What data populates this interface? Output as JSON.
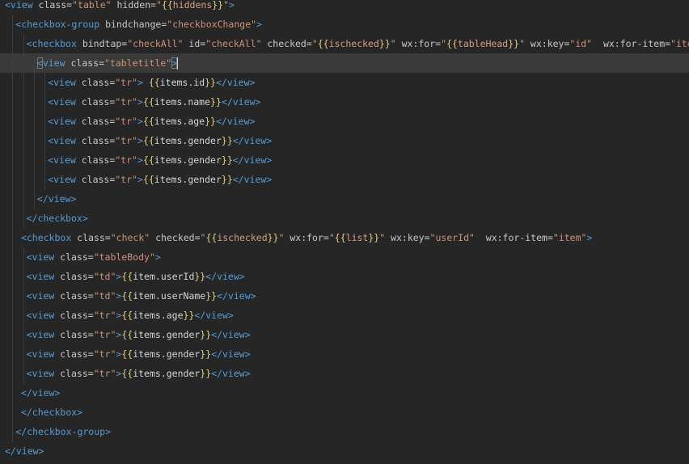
{
  "editor": {
    "language": "wxml",
    "colors": {
      "background": "#262626",
      "current_line": "#3a3a3a",
      "tag": "#569cd6",
      "attribute": "#c8c8c8",
      "string": "#ce9178",
      "mustache": "#e0d080",
      "text": "#d4d4d4"
    },
    "current_line_index": 3,
    "lines": [
      {
        "indent": 0,
        "tokens": [
          [
            "tag",
            "<view"
          ],
          [
            "attr",
            " class"
          ],
          [
            "eq",
            "="
          ],
          [
            "str",
            "\"table\""
          ],
          [
            "attr",
            " hidden"
          ],
          [
            "eq",
            "="
          ],
          [
            "str",
            "\""
          ],
          [
            "must",
            "{{"
          ],
          [
            "strmust",
            "hiddens"
          ],
          [
            "must",
            "}}"
          ],
          [
            "str",
            "\""
          ],
          [
            "tag",
            ">"
          ]
        ]
      },
      {
        "indent": 1,
        "tokens": [
          [
            "tag",
            "<checkbox-group"
          ],
          [
            "attr",
            " bindchange"
          ],
          [
            "eq",
            "="
          ],
          [
            "str",
            "\"checkboxChange\""
          ],
          [
            "tag",
            ">"
          ]
        ]
      },
      {
        "indent": 2,
        "tokens": [
          [
            "tag",
            "<checkbox"
          ],
          [
            "attr",
            " bindtap"
          ],
          [
            "eq",
            "="
          ],
          [
            "str",
            "\"checkAll\""
          ],
          [
            "attr",
            " id"
          ],
          [
            "eq",
            "="
          ],
          [
            "str",
            "\"checkAll\""
          ],
          [
            "attr",
            " checked"
          ],
          [
            "eq",
            "="
          ],
          [
            "str",
            "\""
          ],
          [
            "must",
            "{{"
          ],
          [
            "strmust",
            "ischecked"
          ],
          [
            "must",
            "}}"
          ],
          [
            "str",
            "\""
          ],
          [
            "attr",
            " wx:for"
          ],
          [
            "eq",
            "="
          ],
          [
            "str",
            "\""
          ],
          [
            "must",
            "{{"
          ],
          [
            "strmust",
            "tableHead"
          ],
          [
            "must",
            "}}"
          ],
          [
            "str",
            "\""
          ],
          [
            "attr",
            " wx:key"
          ],
          [
            "eq",
            "="
          ],
          [
            "str",
            "\"id\""
          ],
          [
            "attr",
            "  wx:for-item"
          ],
          [
            "eq",
            "="
          ],
          [
            "str",
            "\"items\""
          ]
        ]
      },
      {
        "indent": 3,
        "tokens": [
          [
            "bracketbox",
            "<"
          ],
          [
            "tag",
            "view"
          ],
          [
            "attr",
            " class"
          ],
          [
            "eq",
            "="
          ],
          [
            "str",
            "\"tabletitle\""
          ],
          [
            "bracketbox",
            ">"
          ],
          [
            "caret",
            ""
          ]
        ]
      },
      {
        "indent": 4,
        "tokens": [
          [
            "tag",
            "<view"
          ],
          [
            "attr",
            " class"
          ],
          [
            "eq",
            "="
          ],
          [
            "str",
            "\"tr\""
          ],
          [
            "tag",
            ">"
          ],
          [
            "text",
            " "
          ],
          [
            "must",
            "{{"
          ],
          [
            "text",
            "items.id"
          ],
          [
            "must",
            "}}"
          ],
          [
            "tag",
            "</view>"
          ]
        ]
      },
      {
        "indent": 4,
        "tokens": [
          [
            "tag",
            "<view"
          ],
          [
            "attr",
            " class"
          ],
          [
            "eq",
            "="
          ],
          [
            "str",
            "\"tr\""
          ],
          [
            "tag",
            ">"
          ],
          [
            "must",
            "{{"
          ],
          [
            "text",
            "items.name"
          ],
          [
            "must",
            "}}"
          ],
          [
            "tag",
            "</view>"
          ]
        ]
      },
      {
        "indent": 4,
        "tokens": [
          [
            "tag",
            "<view"
          ],
          [
            "attr",
            " class"
          ],
          [
            "eq",
            "="
          ],
          [
            "str",
            "\"tr\""
          ],
          [
            "tag",
            ">"
          ],
          [
            "must",
            "{{"
          ],
          [
            "text",
            "items.age"
          ],
          [
            "must",
            "}}"
          ],
          [
            "tag",
            "</view>"
          ]
        ]
      },
      {
        "indent": 4,
        "tokens": [
          [
            "tag",
            "<view"
          ],
          [
            "attr",
            " class"
          ],
          [
            "eq",
            "="
          ],
          [
            "str",
            "\"tr\""
          ],
          [
            "tag",
            ">"
          ],
          [
            "must",
            "{{"
          ],
          [
            "text",
            "items.gender"
          ],
          [
            "must",
            "}}"
          ],
          [
            "tag",
            "</view>"
          ]
        ]
      },
      {
        "indent": 4,
        "tokens": [
          [
            "tag",
            "<view"
          ],
          [
            "attr",
            " class"
          ],
          [
            "eq",
            "="
          ],
          [
            "str",
            "\"tr\""
          ],
          [
            "tag",
            ">"
          ],
          [
            "must",
            "{{"
          ],
          [
            "text",
            "items.gender"
          ],
          [
            "must",
            "}}"
          ],
          [
            "tag",
            "</view>"
          ]
        ]
      },
      {
        "indent": 4,
        "tokens": [
          [
            "tag",
            "<view"
          ],
          [
            "attr",
            " class"
          ],
          [
            "eq",
            "="
          ],
          [
            "str",
            "\"tr\""
          ],
          [
            "tag",
            ">"
          ],
          [
            "must",
            "{{"
          ],
          [
            "text",
            "items.gender"
          ],
          [
            "must",
            "}}"
          ],
          [
            "tag",
            "</view>"
          ]
        ]
      },
      {
        "indent": 3,
        "tokens": [
          [
            "tag",
            "</view>"
          ]
        ]
      },
      {
        "indent": 2,
        "tokens": [
          [
            "tag",
            "</checkbox>"
          ]
        ]
      },
      {
        "indent": 1.5,
        "tokens": [
          [
            "tag",
            "<checkbox"
          ],
          [
            "attr",
            " class"
          ],
          [
            "eq",
            "="
          ],
          [
            "str",
            "\"check\""
          ],
          [
            "attr",
            " checked"
          ],
          [
            "eq",
            "="
          ],
          [
            "str",
            "\""
          ],
          [
            "must",
            "{{"
          ],
          [
            "strmust",
            "ischecked"
          ],
          [
            "must",
            "}}"
          ],
          [
            "str",
            "\""
          ],
          [
            "attr",
            " wx:for"
          ],
          [
            "eq",
            "="
          ],
          [
            "str",
            "\""
          ],
          [
            "must",
            "{{"
          ],
          [
            "strmust",
            "list"
          ],
          [
            "must",
            "}}"
          ],
          [
            "str",
            "\""
          ],
          [
            "attr",
            " wx:key"
          ],
          [
            "eq",
            "="
          ],
          [
            "str",
            "\"userId\""
          ],
          [
            "attr",
            "  wx:for-item"
          ],
          [
            "eq",
            "="
          ],
          [
            "str",
            "\"item\""
          ],
          [
            "tag",
            ">"
          ]
        ]
      },
      {
        "indent": 2,
        "tokens": [
          [
            "tag",
            "<view"
          ],
          [
            "attr",
            " class"
          ],
          [
            "eq",
            "="
          ],
          [
            "str",
            "\"tableBody\""
          ],
          [
            "tag",
            ">"
          ]
        ]
      },
      {
        "indent": 2,
        "tokens": [
          [
            "tag",
            "<view"
          ],
          [
            "attr",
            " class"
          ],
          [
            "eq",
            "="
          ],
          [
            "str",
            "\"td\""
          ],
          [
            "tag",
            ">"
          ],
          [
            "must",
            "{{"
          ],
          [
            "text",
            "item.userId"
          ],
          [
            "must",
            "}}"
          ],
          [
            "tag",
            "</view>"
          ]
        ]
      },
      {
        "indent": 2,
        "tokens": [
          [
            "tag",
            "<view"
          ],
          [
            "attr",
            " class"
          ],
          [
            "eq",
            "="
          ],
          [
            "str",
            "\"td\""
          ],
          [
            "tag",
            ">"
          ],
          [
            "must",
            "{{"
          ],
          [
            "text",
            "item.userName"
          ],
          [
            "must",
            "}}"
          ],
          [
            "tag",
            "</view>"
          ]
        ]
      },
      {
        "indent": 2,
        "tokens": [
          [
            "tag",
            "<view"
          ],
          [
            "attr",
            " class"
          ],
          [
            "eq",
            "="
          ],
          [
            "str",
            "\"tr\""
          ],
          [
            "tag",
            ">"
          ],
          [
            "must",
            "{{"
          ],
          [
            "text",
            "items.age"
          ],
          [
            "must",
            "}}"
          ],
          [
            "tag",
            "</view>"
          ]
        ]
      },
      {
        "indent": 2,
        "tokens": [
          [
            "tag",
            "<view"
          ],
          [
            "attr",
            " class"
          ],
          [
            "eq",
            "="
          ],
          [
            "str",
            "\"tr\""
          ],
          [
            "tag",
            ">"
          ],
          [
            "must",
            "{{"
          ],
          [
            "text",
            "items.gender"
          ],
          [
            "must",
            "}}"
          ],
          [
            "tag",
            "</view>"
          ]
        ]
      },
      {
        "indent": 2,
        "tokens": [
          [
            "tag",
            "<view"
          ],
          [
            "attr",
            " class"
          ],
          [
            "eq",
            "="
          ],
          [
            "str",
            "\"tr\""
          ],
          [
            "tag",
            ">"
          ],
          [
            "must",
            "{{"
          ],
          [
            "text",
            "items.gender"
          ],
          [
            "must",
            "}}"
          ],
          [
            "tag",
            "</view>"
          ]
        ]
      },
      {
        "indent": 2,
        "tokens": [
          [
            "tag",
            "<view"
          ],
          [
            "attr",
            " class"
          ],
          [
            "eq",
            "="
          ],
          [
            "str",
            "\"tr\""
          ],
          [
            "tag",
            ">"
          ],
          [
            "must",
            "{{"
          ],
          [
            "text",
            "items.gender"
          ],
          [
            "must",
            "}}"
          ],
          [
            "tag",
            "</view>"
          ]
        ]
      },
      {
        "indent": 1.5,
        "tokens": [
          [
            "tag",
            "</view>"
          ]
        ]
      },
      {
        "indent": 1.5,
        "tokens": [
          [
            "tag",
            "</checkbox>"
          ]
        ]
      },
      {
        "indent": 1,
        "tokens": [
          [
            "tag",
            "</checkbox-group>"
          ]
        ]
      },
      {
        "indent": 0,
        "tokens": [
          [
            "tag",
            "</view>"
          ]
        ]
      }
    ]
  }
}
